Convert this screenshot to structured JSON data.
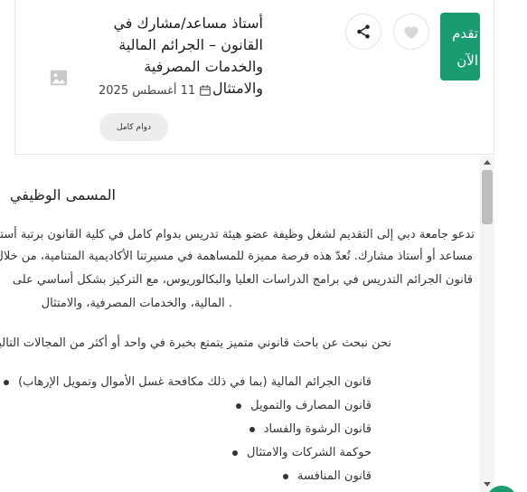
{
  "job": {
    "apply_label": "تقدم الآن",
    "title": "أستاذ مساعد/مشارك في القانون – الجرائم المالية والخدمات المصرفية والامتثال",
    "date": "11 أغسطس 2025",
    "employment_type": "دوام كامل"
  },
  "description": {
    "heading": "المسمى الوظيفي",
    "paragraph_lines": [
      "تدعو جامعة دبي إلى التقديم لشغل وظيفة عضو هيئة تدريس بدوام كامل في كلية القانون برتبة أستاذ",
      "مساعد أو أستاذ مشارك. تُعدّ هذه فرصة مميزة للمساهمة في مسيرتنا الأكاديمية المتنامية، من خلال",
      "قانون الجرائم التدريس في برامج الدراسات العليا والبكالوريوس، مع التركيز بشكل أساسي على",
      ". المالية، والخدمات المصرفية، والامتثال"
    ],
    "intro": "نحن نبحث عن باحث قانوني متميز يتمتع بخبرة في واحد أو أكثر من المجالات التالية:",
    "areas": [
      "قانون الجرائم المالية (بما في ذلك مكافحة غسل الأموال وتمويل الإرهاب)",
      "قانون المصارف والتمويل",
      "قانون الرشوة والفساد",
      "حوكمة الشركات والامتثال",
      "قانون المنافسة"
    ]
  },
  "icons": {
    "like": "heart-icon",
    "share": "share-icon",
    "logo": "image-placeholder-icon",
    "calendar": "calendar-icon"
  },
  "colors": {
    "accent": "#1a9b72"
  }
}
